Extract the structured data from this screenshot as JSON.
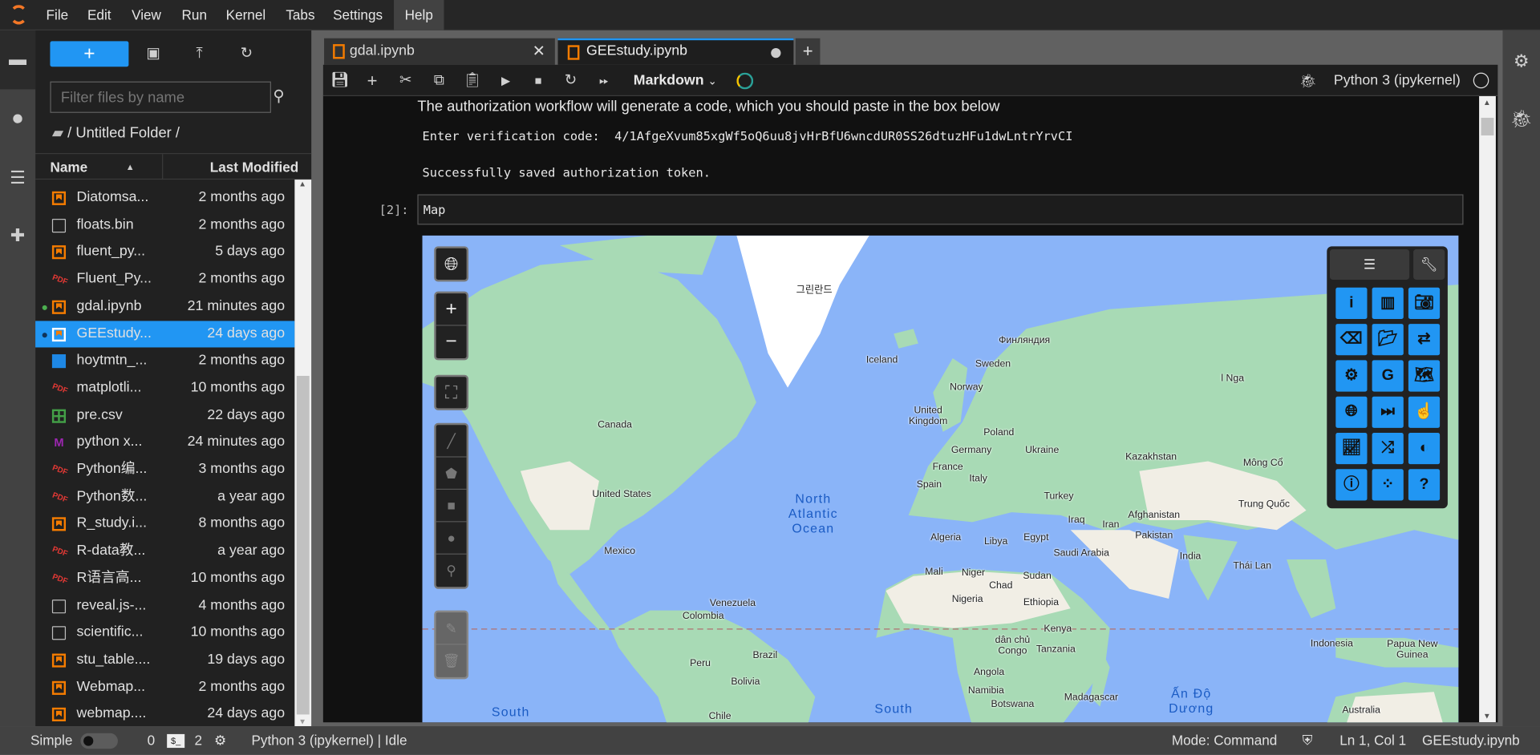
{
  "menubar": {
    "items": [
      "File",
      "Edit",
      "View",
      "Run",
      "Kernel",
      "Tabs",
      "Settings",
      "Help"
    ],
    "active": "Help"
  },
  "filebrowser": {
    "new_label": "+",
    "filter_placeholder": "Filter files by name",
    "breadcrumb": "/ Untitled Folder /",
    "col_name": "Name",
    "col_modified": "Last Modified",
    "files": [
      {
        "name": "Diatomsa...",
        "modified": "2 months ago",
        "type": "notebook"
      },
      {
        "name": "floats.bin",
        "modified": "2 months ago",
        "type": "file"
      },
      {
        "name": "fluent_py...",
        "modified": "5 days ago",
        "type": "notebook"
      },
      {
        "name": "Fluent_Py...",
        "modified": "2 months ago",
        "type": "pdf"
      },
      {
        "name": "gdal.ipynb",
        "modified": "21 minutes ago",
        "type": "notebook",
        "running": true
      },
      {
        "name": "GEEstudy...",
        "modified": "24 days ago",
        "type": "notebook",
        "running": true,
        "selected": true
      },
      {
        "name": "hoytmtn_...",
        "modified": "2 months ago",
        "type": "image"
      },
      {
        "name": "matplotli...",
        "modified": "10 months ago",
        "type": "pdf"
      },
      {
        "name": "pre.csv",
        "modified": "22 days ago",
        "type": "csv"
      },
      {
        "name": "python x...",
        "modified": "24 minutes ago",
        "type": "markdown"
      },
      {
        "name": "Python编...",
        "modified": "3 months ago",
        "type": "pdf"
      },
      {
        "name": "Python数...",
        "modified": "a year ago",
        "type": "pdf"
      },
      {
        "name": "R_study.i...",
        "modified": "8 months ago",
        "type": "notebook"
      },
      {
        "name": "R-data教...",
        "modified": "a year ago",
        "type": "pdf"
      },
      {
        "name": "R语言高...",
        "modified": "10 months ago",
        "type": "pdf"
      },
      {
        "name": "reveal.js-...",
        "modified": "4 months ago",
        "type": "file"
      },
      {
        "name": "scientific...",
        "modified": "10 months ago",
        "type": "file"
      },
      {
        "name": "stu_table....",
        "modified": "19 days ago",
        "type": "notebook"
      },
      {
        "name": "Webmap...",
        "modified": "2 months ago",
        "type": "notebook"
      },
      {
        "name": "webmap....",
        "modified": "24 days ago",
        "type": "notebook"
      }
    ]
  },
  "tabs": [
    {
      "label": "gdal.ipynb",
      "active": false
    },
    {
      "label": "GEEstudy.ipynb",
      "active": true
    }
  ],
  "toolbar": {
    "cell_type": "Markdown",
    "kernel": "Python 3 (ipykernel)"
  },
  "notebook": {
    "auth_text": "The authorization workflow will generate a code, which you should paste in the box below",
    "verification_line": "Enter verification code:  4/1AfgeXvum85xgWf5oQ6uu8jvHrBfU6wncdUR0SS26dtuzHFu1dwLntrYrvCI",
    "saved_line": "Successfully saved authorization token.",
    "cell_prompt": "[2]:",
    "cell_source": "Map"
  },
  "map": {
    "labels": {
      "greenland": "그린란드",
      "iceland": "Iceland",
      "finland": "Финляндия",
      "sweden": "Sweden",
      "norway": "Norway",
      "uk": "United\nKingdom",
      "poland": "Poland",
      "germany": "Germany",
      "ukraine": "Ukraine",
      "france": "France",
      "italy": "Italy",
      "spain": "Spain",
      "turkey": "Turkey",
      "iraq": "Iraq",
      "iran": "Iran",
      "kazakhstan": "Kazakhstan",
      "mongolia": "Mông Cổ",
      "russia": "l Nga",
      "afghanistan": "Afghanistan",
      "pakistan": "Pakistan",
      "india": "India",
      "china": "Trung Quốc",
      "thailand": "Thái Lan",
      "indonesia": "Indonesia",
      "png": "Papua New\nGuinea",
      "australia": "Australia",
      "algeria": "Algeria",
      "libya": "Libya",
      "egypt": "Egypt",
      "saudi": "Saudi Arabia",
      "mali": "Mali",
      "niger": "Niger",
      "chad": "Chad",
      "sudan": "Sudan",
      "nigeria": "Nigeria",
      "ethiopia": "Ethiopia",
      "kenya": "Kenya",
      "drc": "dân chủ\nCongo",
      "tanzania": "Tanzania",
      "angola": "Angola",
      "namibia": "Namibia",
      "botswana": "Botswana",
      "madagascar": "Madagascar",
      "canada": "Canada",
      "usa": "United States",
      "mexico": "Mexico",
      "venezuela": "Venezuela",
      "colombia": "Colombia",
      "brazil": "Brazil",
      "peru": "Peru",
      "bolivia": "Bolivia",
      "chile": "Chile",
      "n_atlantic": "North\nAtlantic\nOcean",
      "s_pacific": "South",
      "s_atlantic": "South",
      "indian": "Ấn Độ\nDương"
    },
    "colors": {
      "water": "#8ab4f8",
      "land": "#a8dab5",
      "desert": "#f1eee5",
      "ice": "#ffffff"
    }
  },
  "statusbar": {
    "mode_label": "Simple",
    "terminals": "0",
    "kernels": "2",
    "kernel_status": "Python 3 (ipykernel) | Idle",
    "mode": "Mode: Command",
    "position": "Ln 1, Col 1",
    "file": "GEEstudy.ipynb"
  },
  "colors": {
    "accent": "#2196f3",
    "notebook_icon": "#f57c00",
    "pdf_icon": "#e53935"
  }
}
